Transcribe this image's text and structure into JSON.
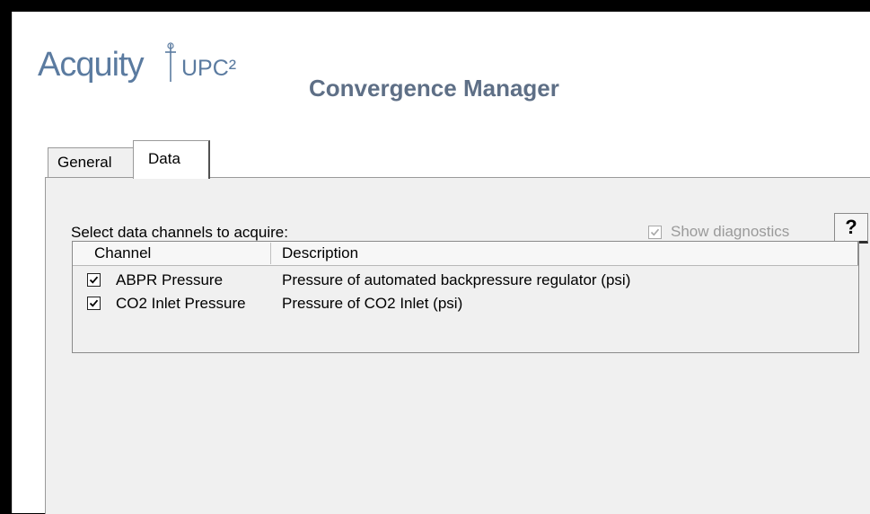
{
  "header": {
    "logo_brand": "Acquity",
    "logo_suffix": "UPC²",
    "title": "Convergence Manager"
  },
  "tabs": [
    {
      "label": "General",
      "active": false
    },
    {
      "label": "Data",
      "active": true
    }
  ],
  "data_tab": {
    "prompt": "Select data channels to acquire:",
    "show_diagnostics": {
      "label": "Show diagnostics",
      "checked": true,
      "enabled": false
    },
    "help_label": "?",
    "columns": [
      "Channel",
      "Description"
    ],
    "rows": [
      {
        "checked": true,
        "channel": "ABPR Pressure",
        "description": "Pressure of automated backpressure regulator (psi)"
      },
      {
        "checked": true,
        "channel": "CO2 Inlet Pressure",
        "description": "Pressure of CO2 Inlet (psi)"
      }
    ]
  },
  "colors": {
    "brand": "#5b7ba0",
    "title": "#5e6f86",
    "panel": "#f0f0f0"
  }
}
